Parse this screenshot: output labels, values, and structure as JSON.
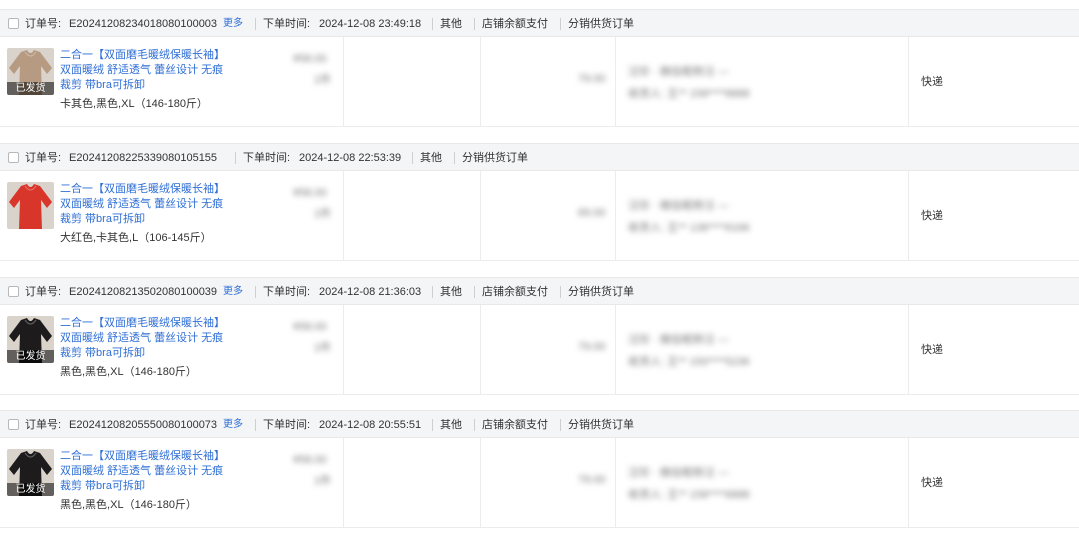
{
  "labels": {
    "order_no_label": "订单号:",
    "time_label": "下单时间:",
    "more": "更多"
  },
  "orders": [
    {
      "order_no": "E20241208234018080100003",
      "time": "2024-12-08 23:49:18",
      "has_more": true,
      "tags": [
        "其他",
        "店铺余额支付",
        "分销供货订单"
      ],
      "product_title": [
        "二合一【双面磨毛暖绒保暖长袖】",
        "双面暖绒 舒适透气 蕾丝设计 无痕",
        "裁剪 带bra可拆卸"
      ],
      "sku": "卡其色,黑色,XL（146-180斤）",
      "status_badge": "已发货",
      "thumb_color": "#b69a82",
      "price": "¥58.00",
      "qty": "1件",
      "amount": "79.00",
      "buyer_line1": "汪珍 · 微信昵称汪 —",
      "buyer_line2": "收货人: 王** 158****8888",
      "shipping": "快递"
    },
    {
      "order_no": "E20241208225339080105155",
      "time": "2024-12-08 22:53:39",
      "has_more": false,
      "tags": [
        "其他",
        "分销供货订单"
      ],
      "product_title": [
        "二合一【双面磨毛暖绒保暖长袖】",
        "双面暖绒 舒适透气 蕾丝设计 无痕",
        "裁剪 带bra可拆卸"
      ],
      "sku": "大红色,卡其色,L（106-145斤）",
      "status_badge": "",
      "thumb_color": "#d8362b",
      "price": "¥58.00",
      "qty": "1件",
      "amount": "69.00",
      "buyer_line1": "汪珍 · 微信昵称汪 —",
      "buyer_line2": "收货人: 王** 138****6166",
      "shipping": "快递"
    },
    {
      "order_no": "E20241208213502080100039",
      "time": "2024-12-08 21:36:03",
      "has_more": true,
      "tags": [
        "其他",
        "店铺余额支付",
        "分销供货订单"
      ],
      "product_title": [
        "二合一【双面磨毛暖绒保暖长袖】",
        "双面暖绒 舒适透气 蕾丝设计 无痕",
        "裁剪 带bra可拆卸"
      ],
      "sku": "黑色,黑色,XL（146-180斤）",
      "status_badge": "已发货",
      "thumb_color": "#1d1b1c",
      "price": "¥58.00",
      "qty": "1件",
      "amount": "79.00",
      "buyer_line1": "汪珍 · 微信昵称汪 —",
      "buyer_line2": "收货人: 王** 150****5236",
      "shipping": "快递"
    },
    {
      "order_no": "E20241208205550080100073",
      "time": "2024-12-08 20:55:51",
      "has_more": true,
      "tags": [
        "其他",
        "店铺余额支付",
        "分销供货订单"
      ],
      "product_title": [
        "二合一【双面磨毛暖绒保暖长袖】",
        "双面暖绒 舒适透气 蕾丝设计 无痕",
        "裁剪 带bra可拆卸"
      ],
      "sku": "黑色,黑色,XL（146-180斤）",
      "status_badge": "已发货",
      "thumb_color": "#1d1b1c",
      "price": "¥58.00",
      "qty": "1件",
      "amount": "79.00",
      "buyer_line1": "汪珍 · 微信昵称汪 —",
      "buyer_line2": "收货人: 王** 158****6888",
      "shipping": "快递"
    }
  ]
}
